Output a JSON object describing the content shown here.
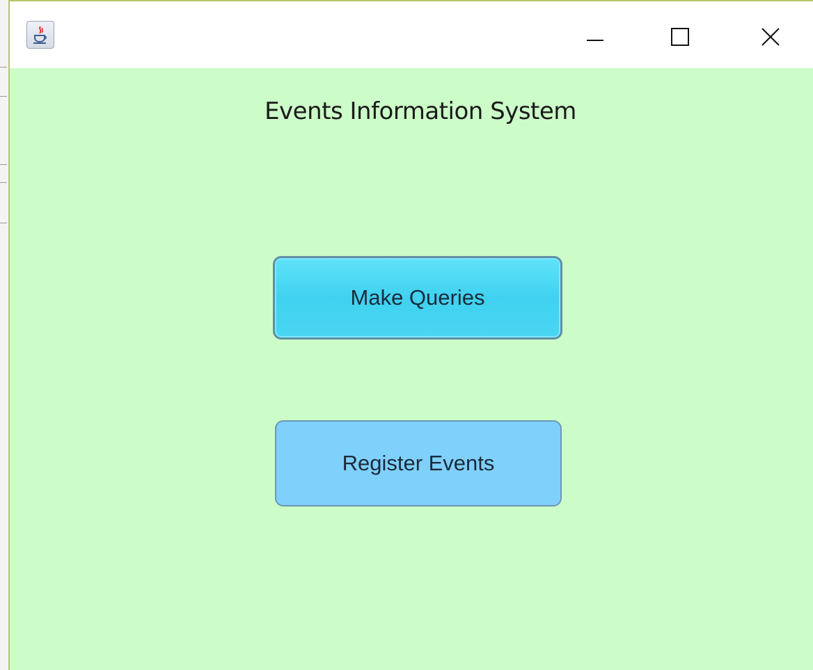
{
  "window": {
    "app_icon": "java-cup-icon",
    "controls": {
      "minimize_icon": "minimize-icon",
      "maximize_icon": "maximize-icon",
      "close_icon": "close-icon"
    },
    "background_color": "#ccfcc8"
  },
  "main": {
    "title": "Events Information System",
    "buttons": {
      "make_queries": "Make Queries",
      "register_events": "Register Events"
    }
  },
  "colors": {
    "make_queries_button": "#4ad6f2",
    "register_events_button": "#7fd0fb"
  }
}
